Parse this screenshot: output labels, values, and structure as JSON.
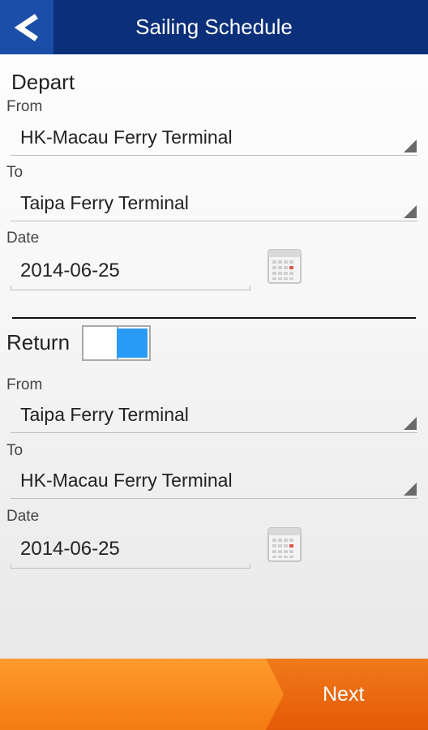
{
  "header": {
    "title": "Sailing Schedule"
  },
  "depart": {
    "heading": "Depart",
    "from_label": "From",
    "from_value": "HK-Macau Ferry Terminal",
    "to_label": "To",
    "to_value": "Taipa Ferry Terminal",
    "date_label": "Date",
    "date_value": "2014-06-25"
  },
  "return": {
    "heading": "Return",
    "toggle_on": true,
    "from_label": "From",
    "from_value": "Taipa Ferry Terminal",
    "to_label": "To",
    "to_value": "HK-Macau Ferry Terminal",
    "date_label": "Date",
    "date_value": "2014-06-25"
  },
  "footer": {
    "next_label": "Next"
  },
  "icons": {
    "back": "back-arrow-icon",
    "calendar": "calendar-icon",
    "dropdown": "dropdown-caret-icon"
  },
  "colors": {
    "header_bg": "#0c2f7a",
    "back_bg": "#1a4ea8",
    "toggle_on": "#2a9bf5",
    "footer_bg": "#f47b10"
  }
}
